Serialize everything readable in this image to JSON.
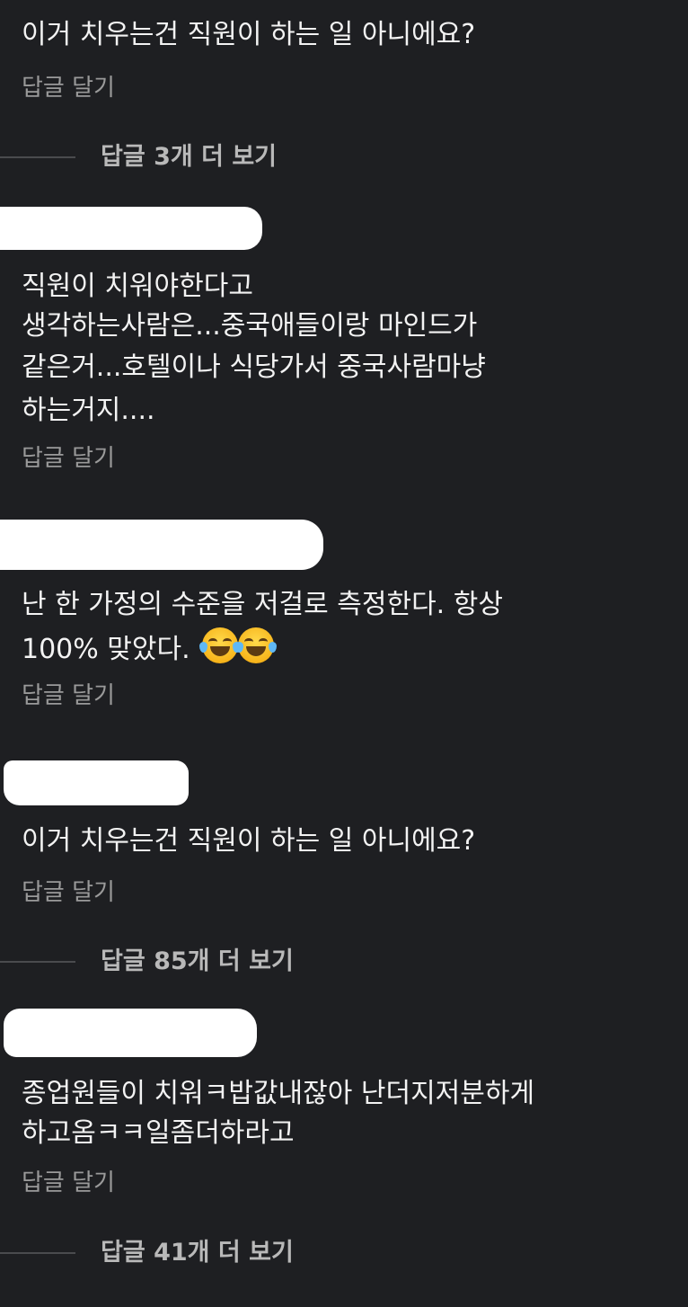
{
  "reply_label": "답글 달기",
  "comments": [
    {
      "author": "",
      "lines": [
        "이거 치우는건 직원이 하는 일 아니에요?"
      ]
    },
    {
      "author": "",
      "lines": [
        "직원이 치워야한다고",
        "생각하는사람은...중국애들이랑 마인드가",
        "같은거...호텔이나 식당가서 중국사람마냥",
        "하는거지...."
      ]
    },
    {
      "author": "",
      "lines": [
        "난 한 가정의 수준을 저걸로 측정한다. 항상",
        "100% 맞았다."
      ],
      "emoji": [
        "face-with-tears-of-joy-icon",
        "face-with-tears-of-joy-icon"
      ]
    },
    {
      "author": "",
      "lines": [
        "이거 치우는건 직원이 하는 일 아니에요?"
      ]
    },
    {
      "author": "",
      "lines": [
        "종업원들이 치워ㅋ밥값내잖아 난더지저분하게",
        "하고옴ㅋㅋ일좀더하라고"
      ]
    }
  ],
  "more_replies": [
    {
      "label": "답글 3개 더 보기"
    },
    {
      "label": "답글 85개 더 보기"
    },
    {
      "label": "답글 41개 더 보기"
    }
  ]
}
